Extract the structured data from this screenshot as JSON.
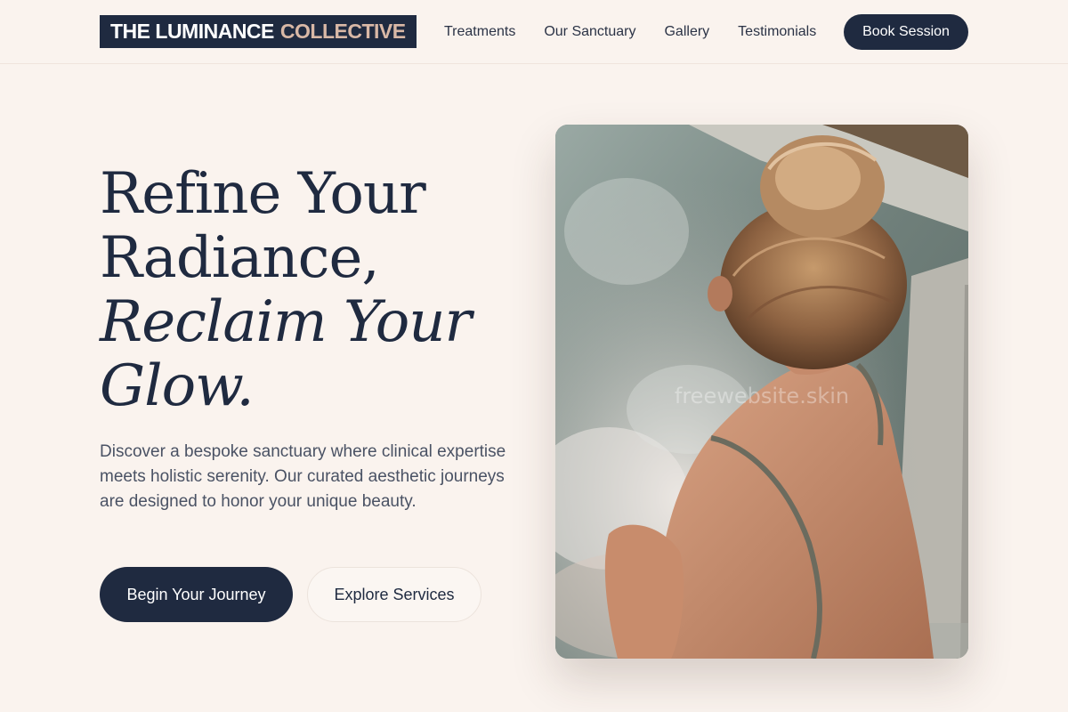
{
  "header": {
    "logo_primary": "THE LUMINANCE",
    "logo_accent": "COLLECTIVE",
    "nav": [
      "Treatments",
      "Our Sanctuary",
      "Gallery",
      "Testimonials"
    ],
    "cta_label": "Book Session"
  },
  "hero": {
    "title_line1": "Refine Your",
    "title_line2": "Radiance,",
    "title_line3": "Reclaim Your",
    "title_line4": "Glow.",
    "description": "Discover a bespoke sanctuary where clinical expertise meets holistic serenity. Our curated aesthetic journeys are designed to honor your unique beauty.",
    "primary_button": "Begin Your Journey",
    "secondary_button": "Explore Services",
    "image_watermark": "freewebsite.skin"
  },
  "colors": {
    "background": "#faf3ee",
    "navy": "#1f2a40",
    "accent": "#d9b8a6",
    "body_text": "#4a5264"
  }
}
